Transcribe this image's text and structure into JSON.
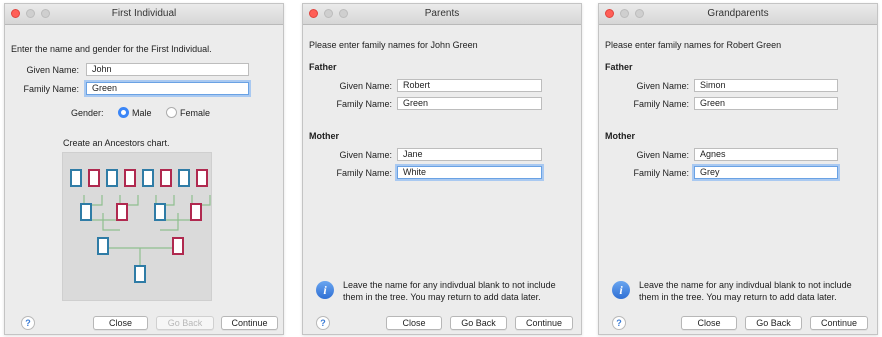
{
  "w1": {
    "title": "First Individual",
    "prompt": "Enter the name and gender for the First Individual.",
    "given_label": "Given Name:",
    "given_value": "John",
    "family_label": "Family Name:",
    "family_value": "Green",
    "gender_label": "Gender:",
    "male_label": "Male",
    "female_label": "Female",
    "gender_selected": "Male",
    "chart_caption": "Create an Ancestors chart.",
    "close_label": "Close",
    "back_label": "Go Back",
    "continue_label": "Continue",
    "help_glyph": "?"
  },
  "w2": {
    "title": "Parents",
    "prompt": "Please enter family names for John Green",
    "father_heading": "Father",
    "father_given_label": "Given Name:",
    "father_given_value": "Robert",
    "father_family_label": "Family Name:",
    "father_family_value": "Green",
    "mother_heading": "Mother",
    "mother_given_label": "Given Name:",
    "mother_given_value": "Jane",
    "mother_family_label": "Family Name:",
    "mother_family_value": "White",
    "info_line1": "Leave the name for any indivdual blank to not include",
    "info_line2": "them in the tree. You may return to add data later.",
    "info_glyph": "i",
    "close_label": "Close",
    "back_label": "Go Back",
    "continue_label": "Continue",
    "help_glyph": "?"
  },
  "w3": {
    "title": "Grandparents",
    "prompt": "Please enter family names for Robert Green",
    "father_heading": "Father",
    "father_given_label": "Given Name:",
    "father_given_value": "Simon",
    "father_family_label": "Family Name:",
    "father_family_value": "Green",
    "mother_heading": "Mother",
    "mother_given_label": "Given Name:",
    "mother_given_value": "Agnes",
    "mother_family_label": "Family Name:",
    "mother_family_value": "Grey",
    "info_line1": "Leave the name for any indivdual blank to not include",
    "info_line2": "them in the tree. You may return to add data later.",
    "info_glyph": "i",
    "close_label": "Close",
    "back_label": "Go Back",
    "continue_label": "Continue",
    "help_glyph": "?"
  },
  "colors": {
    "male_box": "#2f7ca6",
    "female_box": "#b0294f",
    "connector": "#8fbf8f",
    "close_dot": "#ff5f57",
    "focus_ring": "#a9c9f1",
    "radio_selected": "#3b86f7"
  },
  "icons": [
    "help-icon",
    "info-icon",
    "ancestors-chart-icon"
  ]
}
